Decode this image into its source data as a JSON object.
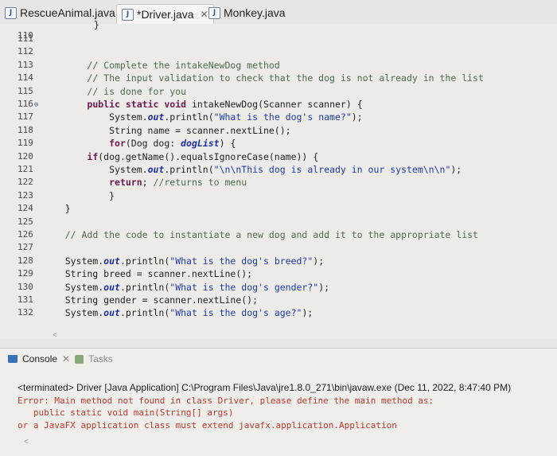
{
  "tabs": [
    {
      "label": "RescueAnimal.java",
      "active": false
    },
    {
      "label": "*Driver.java",
      "active": true,
      "close": "✕"
    },
    {
      "label": "Monkey.java",
      "active": false
    }
  ],
  "editor": {
    "top_line_number": "110",
    "top_line_code": "}",
    "lines": [
      {
        "num": "111",
        "code": ""
      },
      {
        "num": "112",
        "code": ""
      },
      {
        "num": "113",
        "code": "        // Complete the intakeNewDog method"
      },
      {
        "num": "114",
        "code": "        // The input validation to check that the dog is not already in the list"
      },
      {
        "num": "115",
        "code": "        // is done for you"
      },
      {
        "num": "116",
        "code": "        public static void intakeNewDog(Scanner scanner) {"
      },
      {
        "num": "117",
        "code": "            System.out.println(\"What is the dog's name?\");"
      },
      {
        "num": "118",
        "code": "            String name = scanner.nextLine();"
      },
      {
        "num": "119",
        "code": "            for(Dog dog: dogList) {"
      },
      {
        "num": "120",
        "code": "        if(dog.getName().equalsIgnoreCase(name)) {"
      },
      {
        "num": "121",
        "code": "            System.out.println(\"\\n\\nThis dog is already in our system\\n\\n\");"
      },
      {
        "num": "122",
        "code": "            return; //returns to menu"
      },
      {
        "num": "123",
        "code": "            }"
      },
      {
        "num": "124",
        "code": "    }"
      },
      {
        "num": "125",
        "code": ""
      },
      {
        "num": "126",
        "code": "    // Add the code to instantiate a new dog and add it to the appropriate list"
      },
      {
        "num": "127",
        "code": ""
      },
      {
        "num": "128",
        "code": "    System.out.println(\"What is the dog's breed?\");"
      },
      {
        "num": "129",
        "code": "    String breed = scanner.nextLine();"
      },
      {
        "num": "130",
        "code": "    System.out.println(\"What is the dog's gender?\");"
      },
      {
        "num": "131",
        "code": "    String gender = scanner.nextLine();"
      },
      {
        "num": "132",
        "code": "    System.out.println(\"What is the dog's age?\");"
      }
    ]
  },
  "console": {
    "tab_label": "Console",
    "tab_close": "✕",
    "tasks_label": "Tasks",
    "terminated": "<terminated> Driver [Java Application] C:\\Program Files\\Java\\jre1.8.0_271\\bin\\javaw.exe (Dec 11, 2022, 8:47:40 PM)",
    "error_lines": [
      "Error: Main method not found in class Driver, please define the main method as:",
      "   public static void main(String[] args)",
      "or a JavaFX application class must extend javafx.application.Application"
    ]
  },
  "colors": {
    "comment": "#4e6a52",
    "keyword": "#6e1a52",
    "string": "#1d3aa6",
    "error": "#c0392b"
  }
}
